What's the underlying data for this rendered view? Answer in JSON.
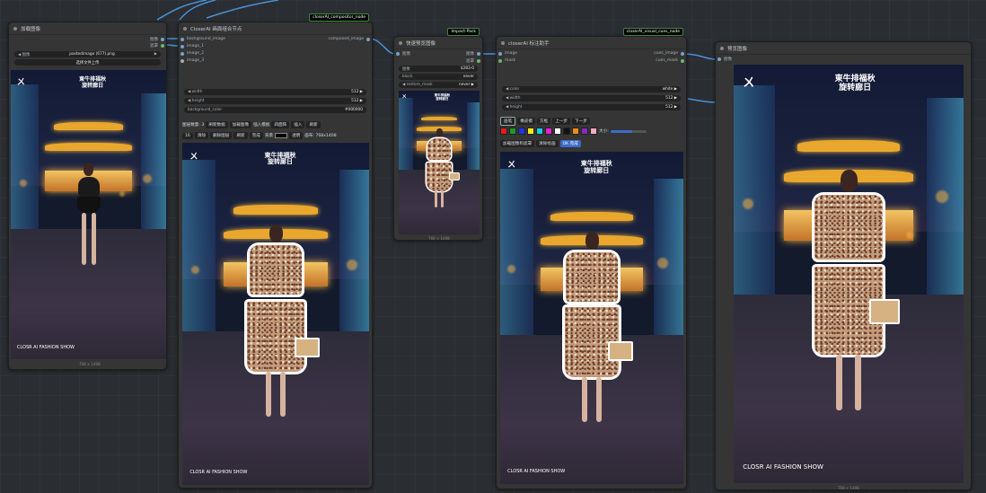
{
  "colors": {
    "wire": "#4a8fd6",
    "accent": "#3b6bc8"
  },
  "load_image_node": {
    "title": "加载图像",
    "outputs": [
      "图像",
      "遮罩"
    ],
    "image_label": "图像",
    "image_value": "pastedimage (677).png",
    "upload_label": "选择文件上传",
    "size": "768 × 1408"
  },
  "compositor_node": {
    "badge": "closerAI_compositor_node",
    "title": "CloserAI 画面组合节点",
    "inputs": [
      "background_image",
      "image_1",
      "image_2",
      "image_3"
    ],
    "output": "composed_image",
    "width_label": "width",
    "width_value": "512",
    "height_label": "height",
    "height_value": "512",
    "bg_color_label": "background_color",
    "bg_color_value": "#000000",
    "toolbar1": [
      "图层数量: 3",
      "刷新数据",
      "加载图像",
      "插入模板",
      "四面阵",
      "插入",
      "刷新"
    ],
    "toolbar2": [
      "16",
      "清除",
      "删除图层",
      "刷新",
      "完成",
      "背景",
      "透明",
      "画布: 768x1408"
    ],
    "size": "768 × 1408"
  },
  "preview_node": {
    "badge": "Impact-Pack",
    "title": "快速预览图像",
    "input": "图像",
    "outputs": [
      "图像",
      "遮罩"
    ],
    "w1_label": "图像",
    "w1_value": "$283-0",
    "w2_label": "block",
    "w2_value": "never",
    "w3_label": "restore_mask",
    "w3_value": "never",
    "size": "768 × 1408"
  },
  "visual_node": {
    "badge": "closerAI_visual_cues_node",
    "title": "closerAI 标注助手",
    "inputs": [
      "image",
      "mask"
    ],
    "outputs": [
      "cues_image",
      "cues_mask"
    ],
    "color_label": "color",
    "color_value": "white",
    "width_label": "width",
    "width_value": "512",
    "height_label": "height",
    "height_value": "512",
    "tools": [
      "画笔",
      "橡皮擦",
      "方框",
      "上一步",
      "下一步"
    ],
    "palette": [
      "#e31b1b",
      "#1a9c2b",
      "#2434e0",
      "#f7e81d",
      "#18c9e8",
      "#e81fd3",
      "#ffffff",
      "#111111",
      "#f08c1a",
      "#8a2ab8",
      "#f2a8c8"
    ],
    "size_label": "大小:",
    "actions": [
      "加载图像和遮罩",
      "清除绘画",
      "OK 完成"
    ]
  },
  "preview2_node": {
    "title": "预览图像",
    "input": "图像",
    "size": "768 × 1408"
  },
  "poster": {
    "brand": "ㄨ",
    "headline_line1": "東牛排福秋",
    "headline_line2": "旋转廊日",
    "caption": "CLOSR AI FASHION SHOW"
  }
}
